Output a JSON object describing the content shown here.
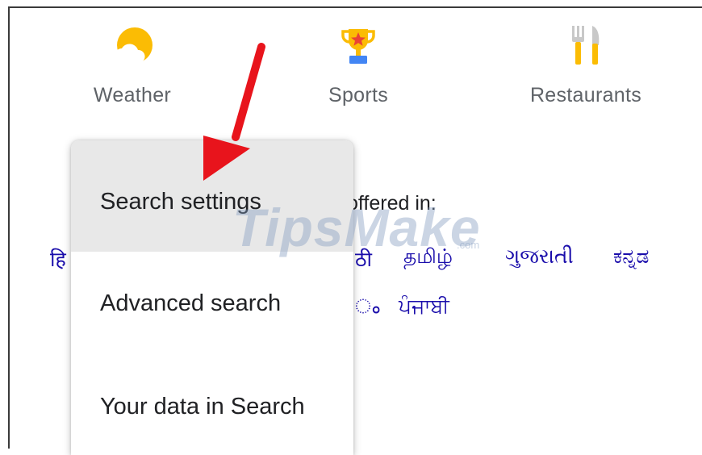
{
  "quick_links": [
    {
      "label": "Weather",
      "icon": "weather-icon"
    },
    {
      "label": "Sports",
      "icon": "trophy-icon"
    },
    {
      "label": "Restaurants",
      "icon": "fork-knife-icon"
    }
  ],
  "offered_in": {
    "text": "offered in:",
    "languages": [
      "हि",
      "ठी",
      "தமிழ்",
      "ગુજરાતી",
      "ಕನ್ನಡ",
      "ം",
      "ਪੰਜਾਬੀ"
    ]
  },
  "menu": {
    "items": [
      {
        "label": "Search settings",
        "active": true
      },
      {
        "label": "Advanced search",
        "active": false
      },
      {
        "label": "Your data in Search",
        "active": false
      }
    ]
  },
  "watermark": {
    "text": "TipsMake",
    "suffix": ".com"
  },
  "colors": {
    "link": "#1a0dab",
    "label_gray": "#5f6368",
    "menu_highlight": "#e8e8e8",
    "arrow_red": "#e8141c",
    "weather_yellow": "#fbbc04"
  }
}
